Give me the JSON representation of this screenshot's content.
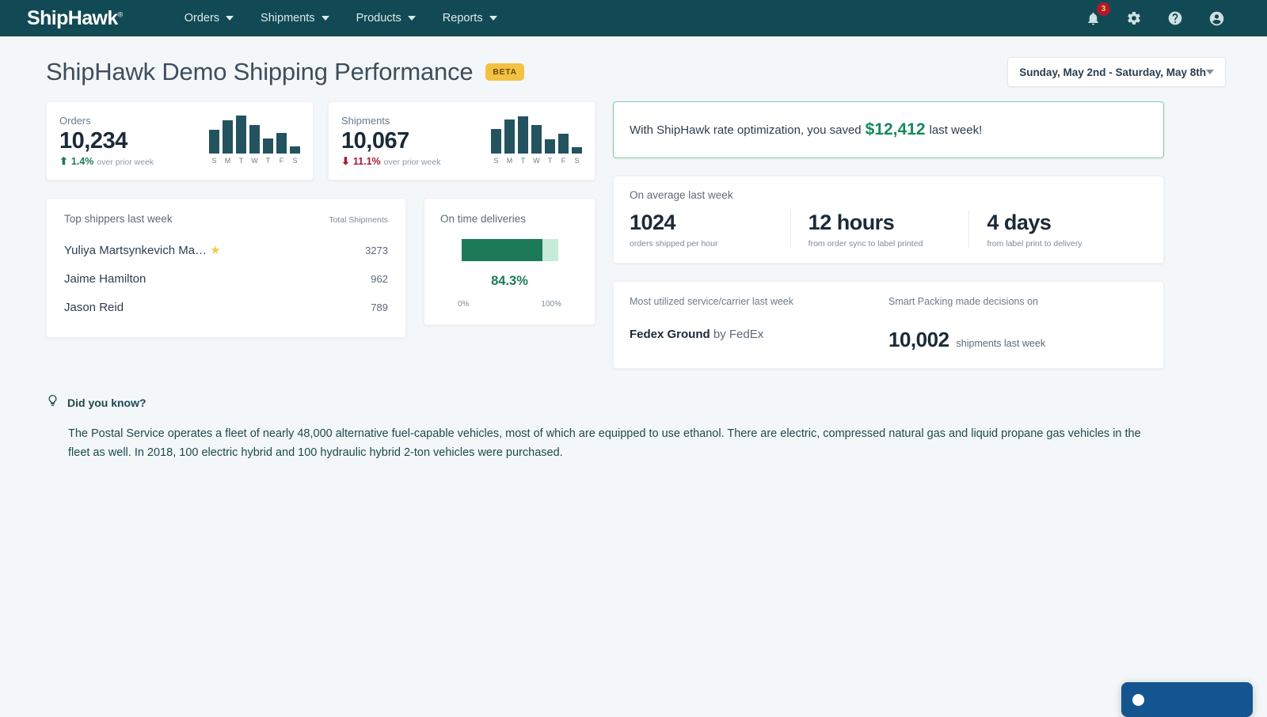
{
  "nav": {
    "logo": "ShipHawk",
    "items": [
      {
        "label": "Orders"
      },
      {
        "label": "Shipments"
      },
      {
        "label": "Products"
      },
      {
        "label": "Reports"
      }
    ],
    "icons": {
      "notifications": "bell-icon",
      "notification_count": "3",
      "settings": "gear-icon",
      "help": "help-icon",
      "account": "account-icon"
    }
  },
  "header": {
    "title": "ShipHawk Demo Shipping Performance",
    "badge": "BETA",
    "date_range": "Sunday, May 2nd - Saturday, May 8th"
  },
  "kpis": [
    {
      "label": "Orders",
      "value": "10,234",
      "delta": "1.4%",
      "delta_direction": "up",
      "delta_note": "over prior week",
      "chart": {
        "type": "bar",
        "categories": [
          "S",
          "M",
          "T",
          "W",
          "T",
          "F",
          "S"
        ],
        "values": [
          30,
          42,
          48,
          36,
          19,
          26,
          9
        ],
        "ylim": [
          0,
          52
        ],
        "color": "#23535f"
      }
    },
    {
      "label": "Shipments",
      "value": "10,067",
      "delta": "11.1%",
      "delta_direction": "down",
      "delta_note": "over prior week",
      "chart": {
        "type": "bar",
        "categories": [
          "S",
          "M",
          "T",
          "W",
          "T",
          "F",
          "S"
        ],
        "values": [
          31,
          43,
          47,
          36,
          18,
          25,
          8
        ],
        "ylim": [
          0,
          52
        ],
        "color": "#23535f"
      }
    }
  ],
  "savings": {
    "prefix": "With ShipHawk rate optimization, you saved",
    "amount": "$12,412",
    "suffix": "last week!",
    "border_color": "#7fceab",
    "amount_color": "#158a5c"
  },
  "top_shippers": {
    "title": "Top shippers last week",
    "column": "Total Shipments",
    "rows": [
      {
        "name": "Yuliya Martsynkevich Ma…",
        "count": "3273",
        "starred": true
      },
      {
        "name": "Jaime Hamilton",
        "count": "962",
        "starred": false
      },
      {
        "name": "Jason Reid",
        "count": "789",
        "starred": false
      }
    ]
  },
  "on_time": {
    "title": "On time deliveries",
    "percent_label": "84.3%",
    "percent_value": 84.3,
    "scale_min": "0%",
    "scale_max": "100%",
    "fill_color": "#1c7a59",
    "track_color": "#c6ecd9"
  },
  "averages": {
    "title": "On average last week",
    "stats": [
      {
        "value": "1024",
        "label": "orders shipped per hour"
      },
      {
        "value": "12 hours",
        "label": "from order sync to label printed"
      },
      {
        "value": "4 days",
        "label": "from label print to delivery"
      }
    ]
  },
  "carrier": {
    "label": "Most utilized service/carrier last week",
    "service": "Fedex Ground",
    "by": "by FedEx"
  },
  "smart_packing": {
    "label": "Smart Packing made decisions on",
    "value": "10,002",
    "note": "shipments last week"
  },
  "did_you_know": {
    "title": "Did you know?",
    "icon": "lightbulb-icon",
    "body": "The Postal Service operates a fleet of nearly 48,000 alternative fuel-capable vehicles, most of which are equipped to use ethanol. There are electric, compressed natural gas and liquid propane gas vehicles in the fleet as well. In 2018, 100 electric hybrid and 100 hydraulic hybrid 2-ton vehicles were purchased."
  },
  "chat_widget": {
    "label": "",
    "color": "#15558f"
  }
}
